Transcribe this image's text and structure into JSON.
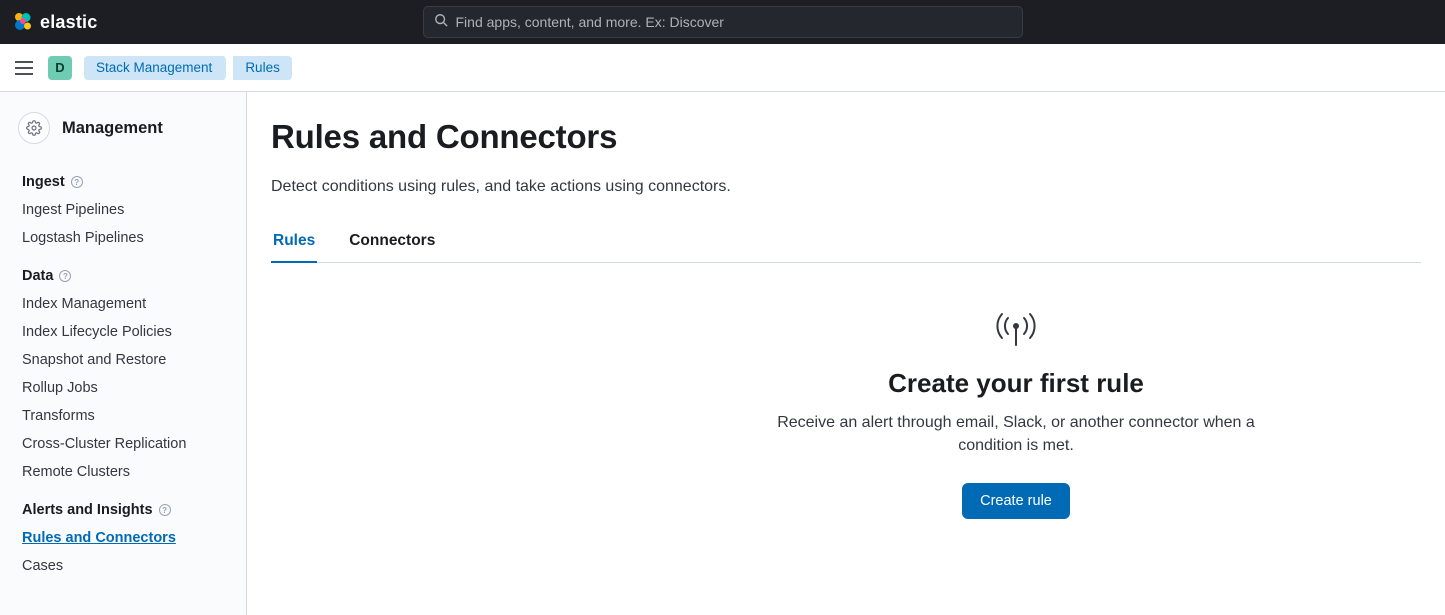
{
  "header": {
    "brand": "elastic",
    "search_placeholder": "Find apps, content, and more. Ex: Discover",
    "space_letter": "D"
  },
  "breadcrumbs": [
    "Stack Management",
    "Rules"
  ],
  "sidebar": {
    "title": "Management",
    "sections": [
      {
        "title": "Ingest",
        "items": [
          "Ingest Pipelines",
          "Logstash Pipelines"
        ]
      },
      {
        "title": "Data",
        "items": [
          "Index Management",
          "Index Lifecycle Policies",
          "Snapshot and Restore",
          "Rollup Jobs",
          "Transforms",
          "Cross-Cluster Replication",
          "Remote Clusters"
        ]
      },
      {
        "title": "Alerts and Insights",
        "items": [
          "Rules and Connectors",
          "Cases"
        ]
      }
    ],
    "active_item": "Rules and Connectors"
  },
  "main": {
    "title": "Rules and Connectors",
    "description": "Detect conditions using rules, and take actions using connectors.",
    "tabs": [
      "Rules",
      "Connectors"
    ],
    "active_tab": "Rules",
    "empty": {
      "title": "Create your first rule",
      "description": "Receive an alert through email, Slack, or another connector when a condition is met.",
      "button": "Create rule"
    }
  }
}
